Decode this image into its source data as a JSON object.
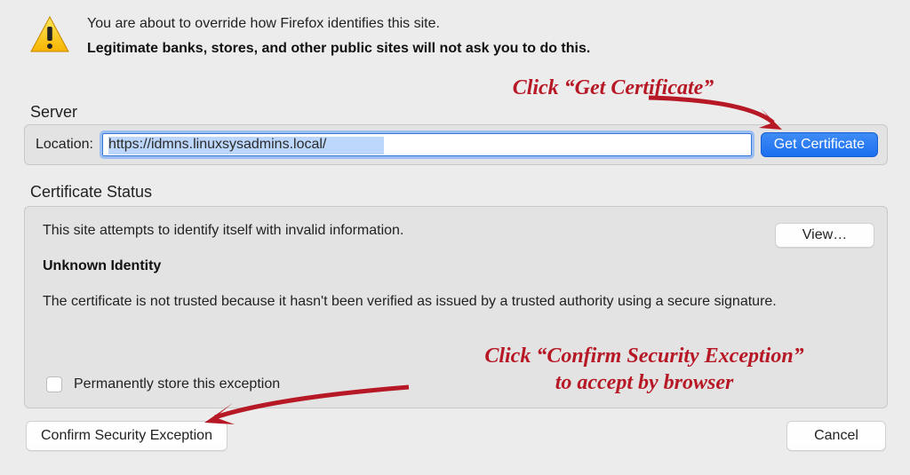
{
  "header": {
    "line1": "You are about to override how Firefox identifies this site.",
    "line2": "Legitimate banks, stores, and other public sites will not ask you to do this."
  },
  "server": {
    "section_label": "Server",
    "location_label": "Location:",
    "location_value": "https://idmns.linuxsysadmins.local/",
    "get_certificate_label": "Get Certificate"
  },
  "status": {
    "section_label": "Certificate Status",
    "attempt_text": "This site attempts to identify itself with invalid information.",
    "unknown_heading": "Unknown Identity",
    "explain_text": "The certificate is not trusted because it hasn't been verified as issued by a trusted authority using a secure signature.",
    "view_label": "View…",
    "permanent_label": "Permanently store this exception"
  },
  "buttons": {
    "confirm_label": "Confirm Security Exception",
    "cancel_label": "Cancel"
  },
  "annotations": {
    "a1": "Click “Get Certificate”",
    "a2_line1": "Click “Confirm Security Exception”",
    "a2_line2": "to accept by browser"
  }
}
